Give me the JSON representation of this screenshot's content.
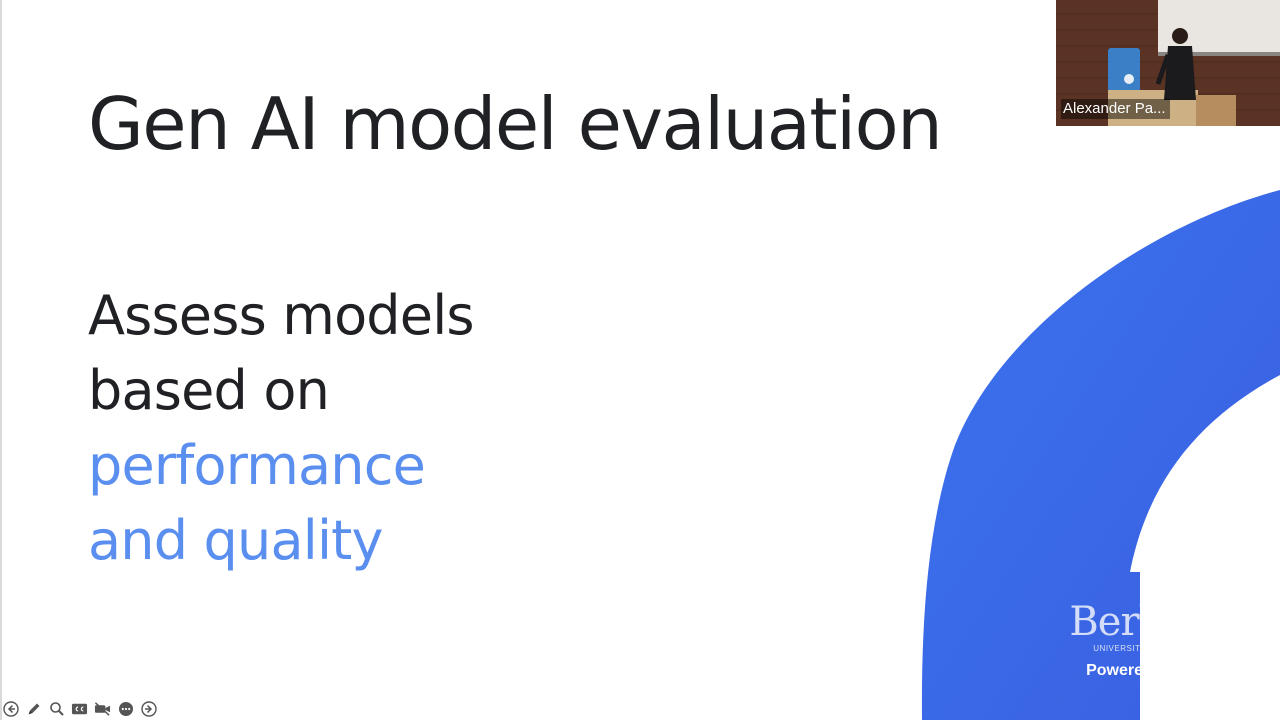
{
  "slide": {
    "title": "Gen AI model evaluation",
    "body_lines": [
      "Assess models",
      "based on",
      "performance",
      "and quality"
    ],
    "colors": {
      "text": "#202124",
      "accent_text": "#5a8ff0",
      "shape_blue": "#3b6ee8"
    }
  },
  "video": {
    "participant_name": "Alexander Pa..."
  },
  "branding": {
    "logo_word": "Berkeley",
    "logo_subtitle": "UNIVERSITY OF CALIFORNIA",
    "powered_by": "Powered by Zoom"
  },
  "toolbar": {
    "buttons": [
      {
        "name": "previous-slide",
        "icon": "arrow-left-icon"
      },
      {
        "name": "pen",
        "icon": "pencil-icon"
      },
      {
        "name": "zoom",
        "icon": "magnifier-icon"
      },
      {
        "name": "captions",
        "icon": "cc-icon"
      },
      {
        "name": "camera",
        "icon": "camera-off-icon"
      },
      {
        "name": "more",
        "icon": "more-icon"
      },
      {
        "name": "next-slide",
        "icon": "arrow-right-icon"
      }
    ]
  }
}
